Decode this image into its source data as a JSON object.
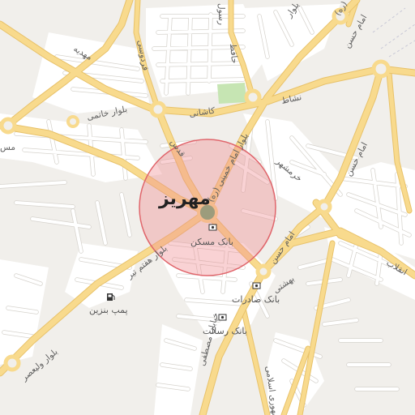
{
  "map": {
    "city_label": "مهریز",
    "colors": {
      "background": "#f1efeb",
      "block": "#ffffff",
      "major_road": "#f7d98b",
      "major_road_casing": "#e9c46e",
      "minor_road": "#ffffff",
      "minor_road_casing": "#d9d6d0",
      "park": "#c6e5b3",
      "radius_fill": "#f08a8e",
      "radius_stroke": "#e0666c",
      "center_dot": "#9c9c7c"
    },
    "road_labels": {
      "mahdieh": "مهدیه",
      "ferdowsi": "فردوسی",
      "rasool": "رسول",
      "hafez": "حافظ",
      "boulevard_top": "بلوار",
      "boulevard_top_right": "(ره)",
      "imam_hasan_top": "امام حسن",
      "nashat": "نشاط",
      "kashani": "کاشانی",
      "khatami": "بلوار خاتمی",
      "imam_khomeini": "بلوار امام خمینی (ره)",
      "qods": "قدس",
      "khoramshahr": "خرمشهر",
      "imam_hasan_right": "امام حسن",
      "imam_hasan_mid": "امام حسن",
      "haft_tir": "بلوار هفتم تیر",
      "beheshti": "بهشتی",
      "enghelab": "انقلاب",
      "mostafa_khomeini": "خیابان مصطفی",
      "jomhoori": "جمهوری اسلامی",
      "valiasr": "بلوار ولیعصر",
      "left_edge": "مس"
    },
    "pois": [
      {
        "id": "bank-maskan",
        "label": "بانک مسکن",
        "icon": "bank-icon"
      },
      {
        "id": "bank-saderat",
        "label": "بانک صادرات",
        "icon": "bank-icon"
      },
      {
        "id": "bank-resalat",
        "label": "بانک رسالت",
        "icon": "bank-icon"
      },
      {
        "id": "gas-station",
        "label": "پمپ بنزین",
        "icon": "gas-station-icon"
      }
    ]
  }
}
